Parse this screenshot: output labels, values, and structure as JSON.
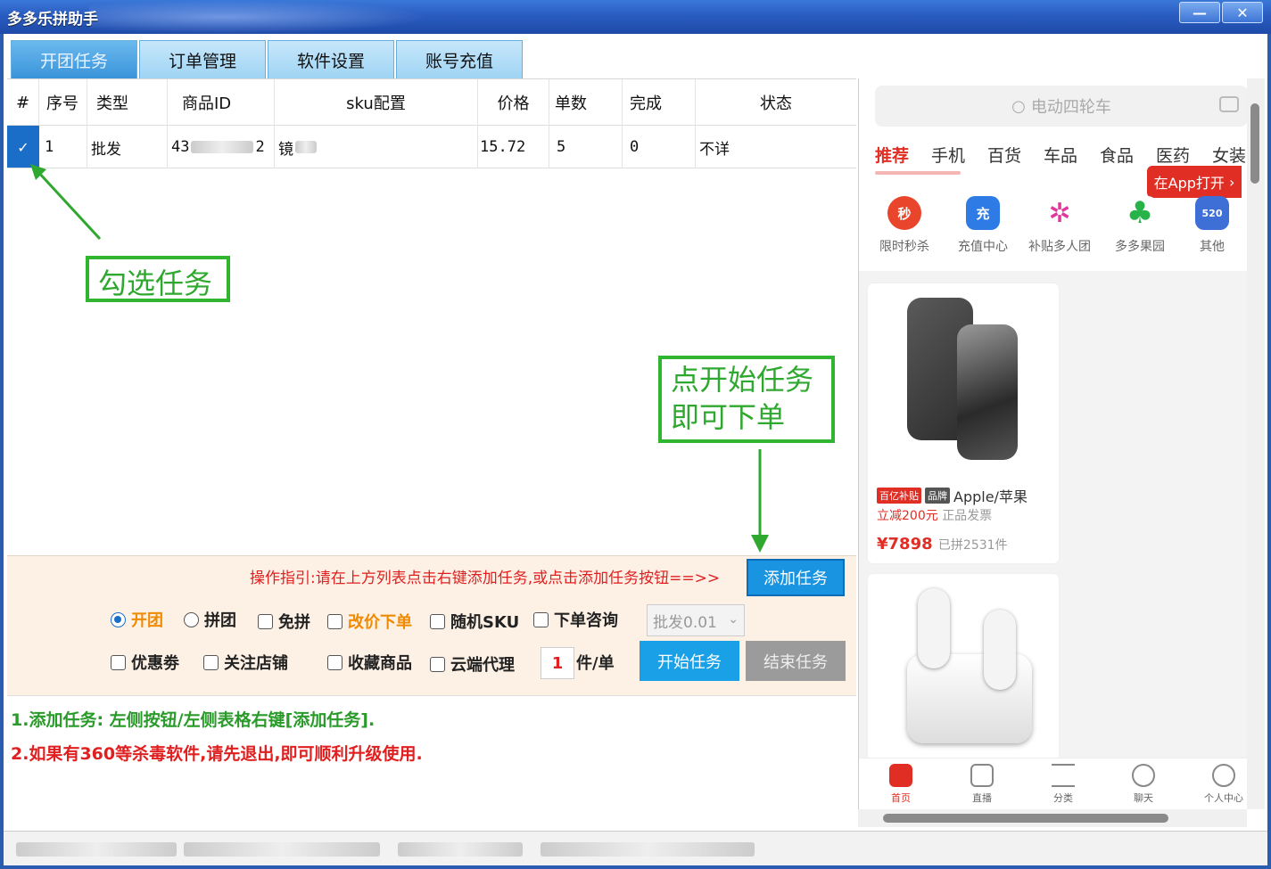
{
  "window": {
    "title": "多多乐拼助手",
    "min_label": "—",
    "close_label": "✕"
  },
  "tabs": [
    {
      "label": "开团任务",
      "active": true
    },
    {
      "label": "订单管理"
    },
    {
      "label": "软件设置"
    },
    {
      "label": "账号充值"
    }
  ],
  "table": {
    "headers": [
      "#",
      "序号",
      "类型",
      "商品ID",
      "sku配置",
      "价格",
      "单数",
      "完成",
      "状态"
    ],
    "rows": [
      {
        "checked": true,
        "seq": "1",
        "type": "批发",
        "id_prefix": "43",
        "id_suffix": "2",
        "sku": "镜",
        "price": "15.72",
        "count": "5",
        "done": "0",
        "status": "不详"
      }
    ]
  },
  "annotations": {
    "select_task": "勾选任务",
    "start_task_line1": "点开始任务",
    "start_task_line2": "即可下单"
  },
  "panel": {
    "guide": "操作指引:请在上方列表点击右键添加任务,或点击添加任务按钮==>>",
    "add_task": "添加任务",
    "mode_open": "开团",
    "mode_join": "拼团",
    "free": "免拼",
    "change_price": "改价下单",
    "random_sku": "随机SKU",
    "order_consult": "下单咨询",
    "select_value": "批发0.01",
    "coupon": "优惠劵",
    "follow_shop": "关注店铺",
    "fav_goods": "收藏商品",
    "cloud_proxy": "云端代理",
    "qty_value": "1",
    "qty_unit": "件/单",
    "start_task": "开始任务",
    "end_task": "结束任务"
  },
  "notes": {
    "line1": "1.添加任务: 左侧按钮/左侧表格右键[添加任务].",
    "line2": "2.如果有360等杀毒软件,请先退出,即可顺利升级使用."
  },
  "web": {
    "search_placeholder": "电动四轮车",
    "categories": [
      "推荐",
      "手机",
      "百货",
      "车品",
      "食品",
      "医药",
      "女装"
    ],
    "open_app": "在App打开",
    "icons": [
      {
        "label": "限时秒杀",
        "glyph": "秒",
        "color": "#e8452c"
      },
      {
        "label": "充值中心",
        "glyph": "充",
        "color": "#2f7be6"
      },
      {
        "label": "补贴多人团",
        "glyph": "✲",
        "color": "#e0399c"
      },
      {
        "label": "多多果园",
        "glyph": "♣",
        "color": "#27b34a"
      },
      {
        "label": "其他",
        "glyph": "520",
        "color": "#3d6fd6"
      }
    ],
    "product1": {
      "tag1": "百亿补贴",
      "tag2": "品牌",
      "name": "Apple/苹果",
      "promo": "立减200元",
      "promo2": "正品发票",
      "price": "¥7898",
      "sold": "已拼2531件"
    },
    "nav": [
      "首页",
      "直播",
      "分类",
      "聊天",
      "个人中心"
    ]
  },
  "colors": {
    "accent_green": "#2fa82f",
    "accent_red": "#e02e24",
    "tab_blue": "#3a94da"
  }
}
